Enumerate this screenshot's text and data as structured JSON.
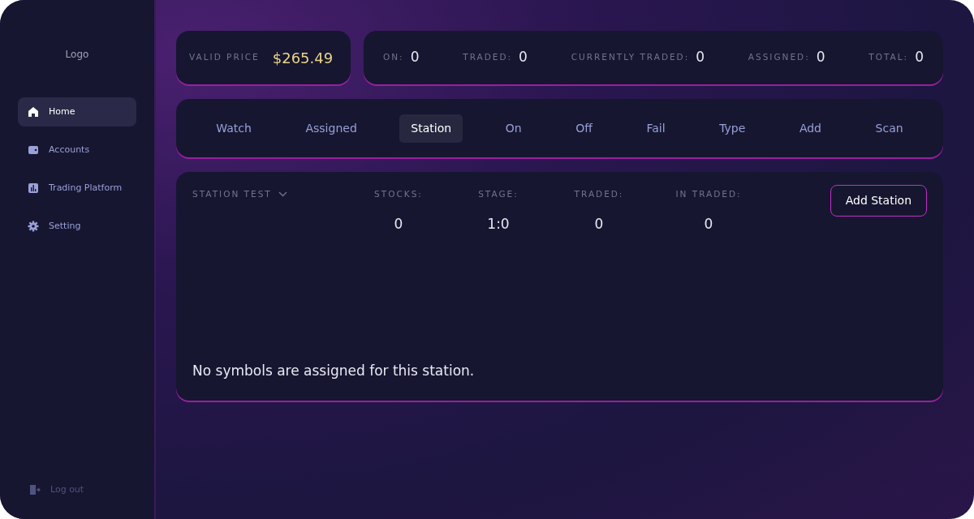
{
  "sidebar": {
    "logo": "Logo",
    "items": [
      {
        "label": "Home",
        "selected": true
      },
      {
        "label": "Accounts",
        "selected": false
      },
      {
        "label": "Trading Platform",
        "selected": false
      },
      {
        "label": "Setting",
        "selected": false
      }
    ],
    "logout": "Log out"
  },
  "price": {
    "label": "VALID PRICE",
    "value": "$265.49"
  },
  "stats": [
    {
      "label": "ON:",
      "value": "0"
    },
    {
      "label": "TRADED:",
      "value": "0"
    },
    {
      "label": "CURRENTLY TRADED:",
      "value": "0"
    },
    {
      "label": "ASSIGNED:",
      "value": "0"
    },
    {
      "label": "TOTAL:",
      "value": "0"
    }
  ],
  "tabs": [
    {
      "label": "Watch",
      "selected": false
    },
    {
      "label": "Assigned",
      "selected": false
    },
    {
      "label": "Station",
      "selected": true
    },
    {
      "label": "On",
      "selected": false
    },
    {
      "label": "Off",
      "selected": false
    },
    {
      "label": "Fail",
      "selected": false
    },
    {
      "label": "Type",
      "selected": false
    },
    {
      "label": "Add",
      "selected": false
    },
    {
      "label": "Scan",
      "selected": false
    }
  ],
  "station": {
    "selector": "STATION TEST",
    "columns": [
      {
        "label": "STOCKS:",
        "value": "0"
      },
      {
        "label": "STAGE:",
        "value": "1:0"
      },
      {
        "label": "TRADED:",
        "value": "0"
      },
      {
        "label": "IN TRADED:",
        "value": "0"
      }
    ],
    "button": "Add Station",
    "empty_message": "No symbols are assigned for this station."
  }
}
